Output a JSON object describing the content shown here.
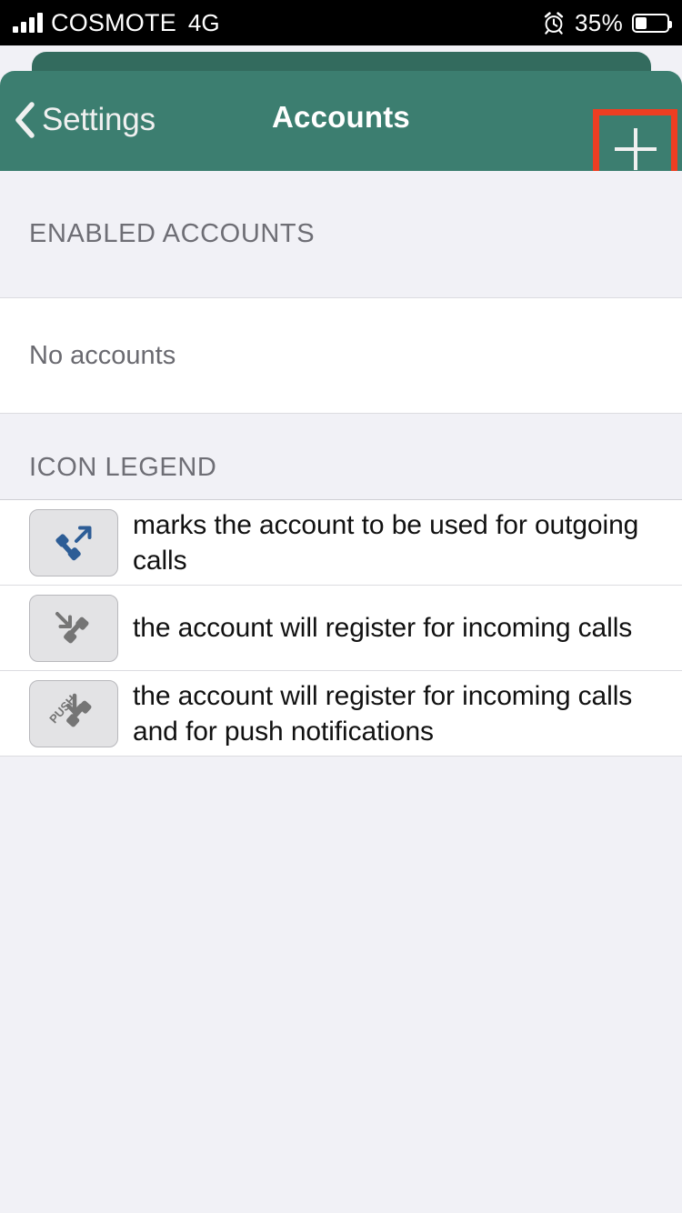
{
  "status_bar": {
    "carrier": "COSMOTE",
    "network": "4G",
    "battery_percent": "35%",
    "battery_level": 35,
    "alarm_icon": "alarm-clock-icon",
    "signal_icon": "signal-bars-icon",
    "battery_icon": "battery-icon"
  },
  "nav": {
    "back_label": "Settings",
    "back_icon": "chevron-left-icon",
    "title": "Accounts",
    "add_icon": "plus-icon",
    "highlight_color": "#ed3e22",
    "bar_color": "#3c7e70"
  },
  "enabled_section": {
    "header": "ENABLED ACCOUNTS",
    "reorder_icon": "reorder-hamburger-icon",
    "empty_label": "No accounts"
  },
  "legend_section": {
    "header": "ICON LEGEND",
    "rows": [
      {
        "icon": "outgoing-call-icon",
        "icon_color": "#2d5d96",
        "text": "marks the account to be used for outgoing calls"
      },
      {
        "icon": "incoming-call-icon",
        "icon_color": "#757575",
        "text": "the account will register for incoming calls"
      },
      {
        "icon": "incoming-call-push-icon",
        "icon_color": "#757575",
        "badge": "PUSH",
        "text": "the account will register for incoming calls and for push notifications"
      }
    ]
  }
}
